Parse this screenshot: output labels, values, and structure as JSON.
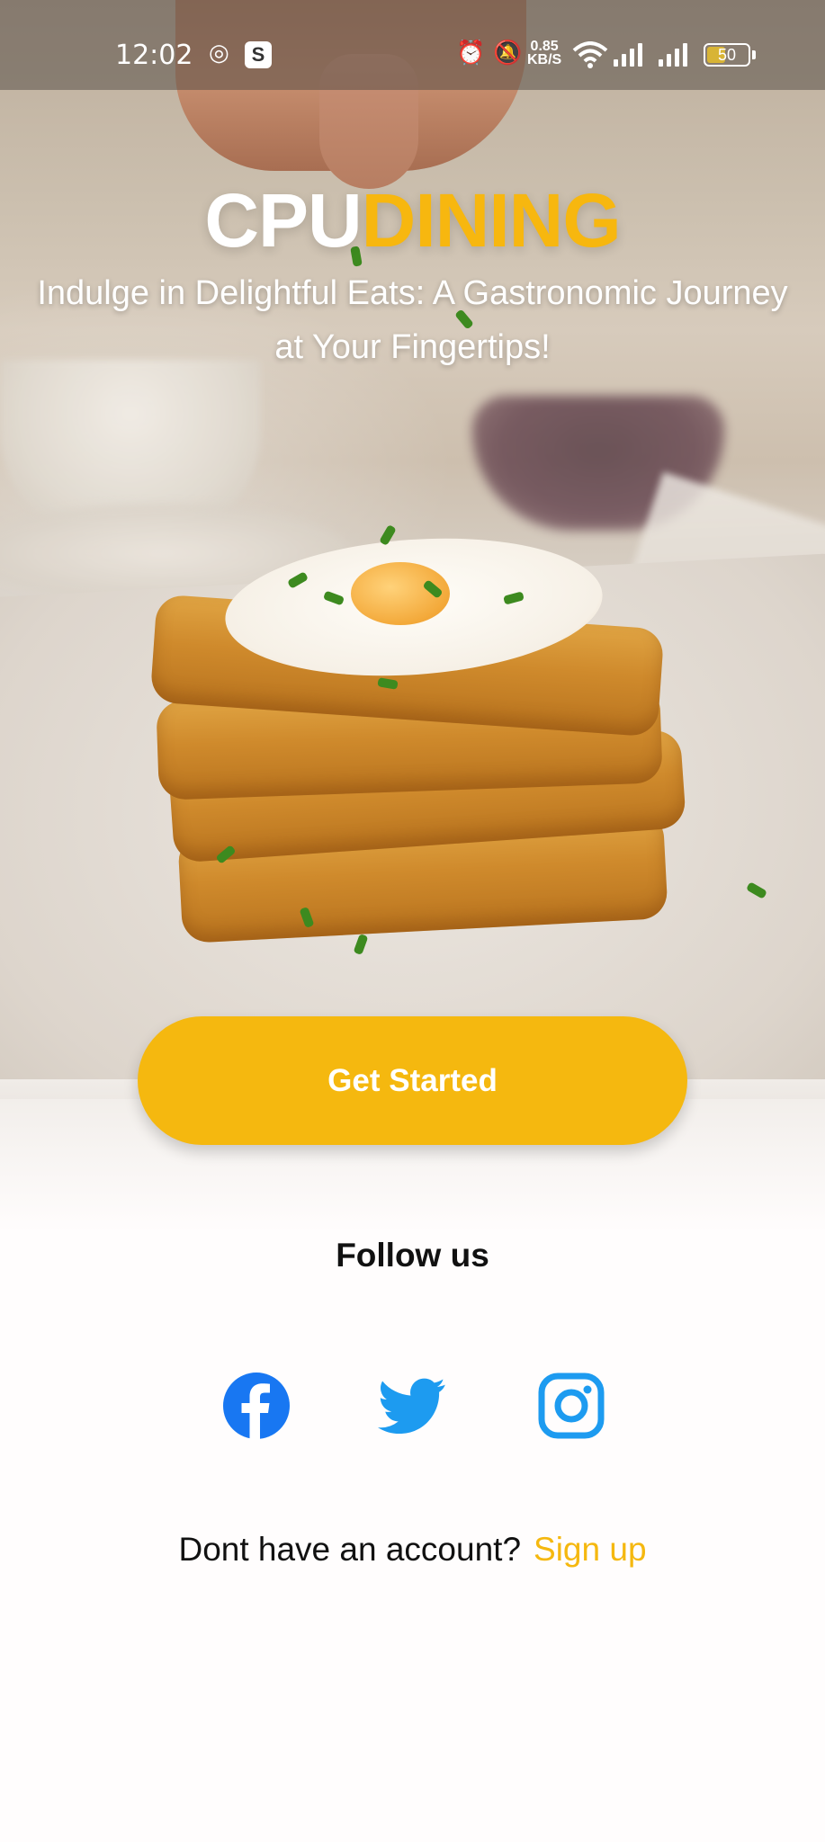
{
  "status_bar": {
    "time": "12:02",
    "s_badge": "S",
    "net_speed_value": "0.85",
    "net_speed_unit": "KB/S",
    "battery": "50",
    "icons": [
      "location-target-icon",
      "s-app-icon",
      "alarm-icon",
      "mute-bell-icon",
      "wifi-icon",
      "signal-icon",
      "signal-icon",
      "battery-icon"
    ]
  },
  "brand": {
    "part1": "CPU",
    "part2": "DINING",
    "color_white": "#ffffff",
    "color_accent": "#f5b80f"
  },
  "tagline": "Indulge in Delightful Eats: A Gastronomic Journey at Your Fingertips!",
  "cta": {
    "label": "Get Started"
  },
  "follow": {
    "title": "Follow us"
  },
  "social": [
    {
      "name": "facebook",
      "icon": "facebook-icon",
      "color": "#1877f2"
    },
    {
      "name": "twitter",
      "icon": "twitter-icon",
      "color": "#1d9bf0"
    },
    {
      "name": "instagram",
      "icon": "instagram-icon",
      "color": "#1d9bf0"
    }
  ],
  "account": {
    "question": "Dont have an account?",
    "link": "Sign up"
  }
}
